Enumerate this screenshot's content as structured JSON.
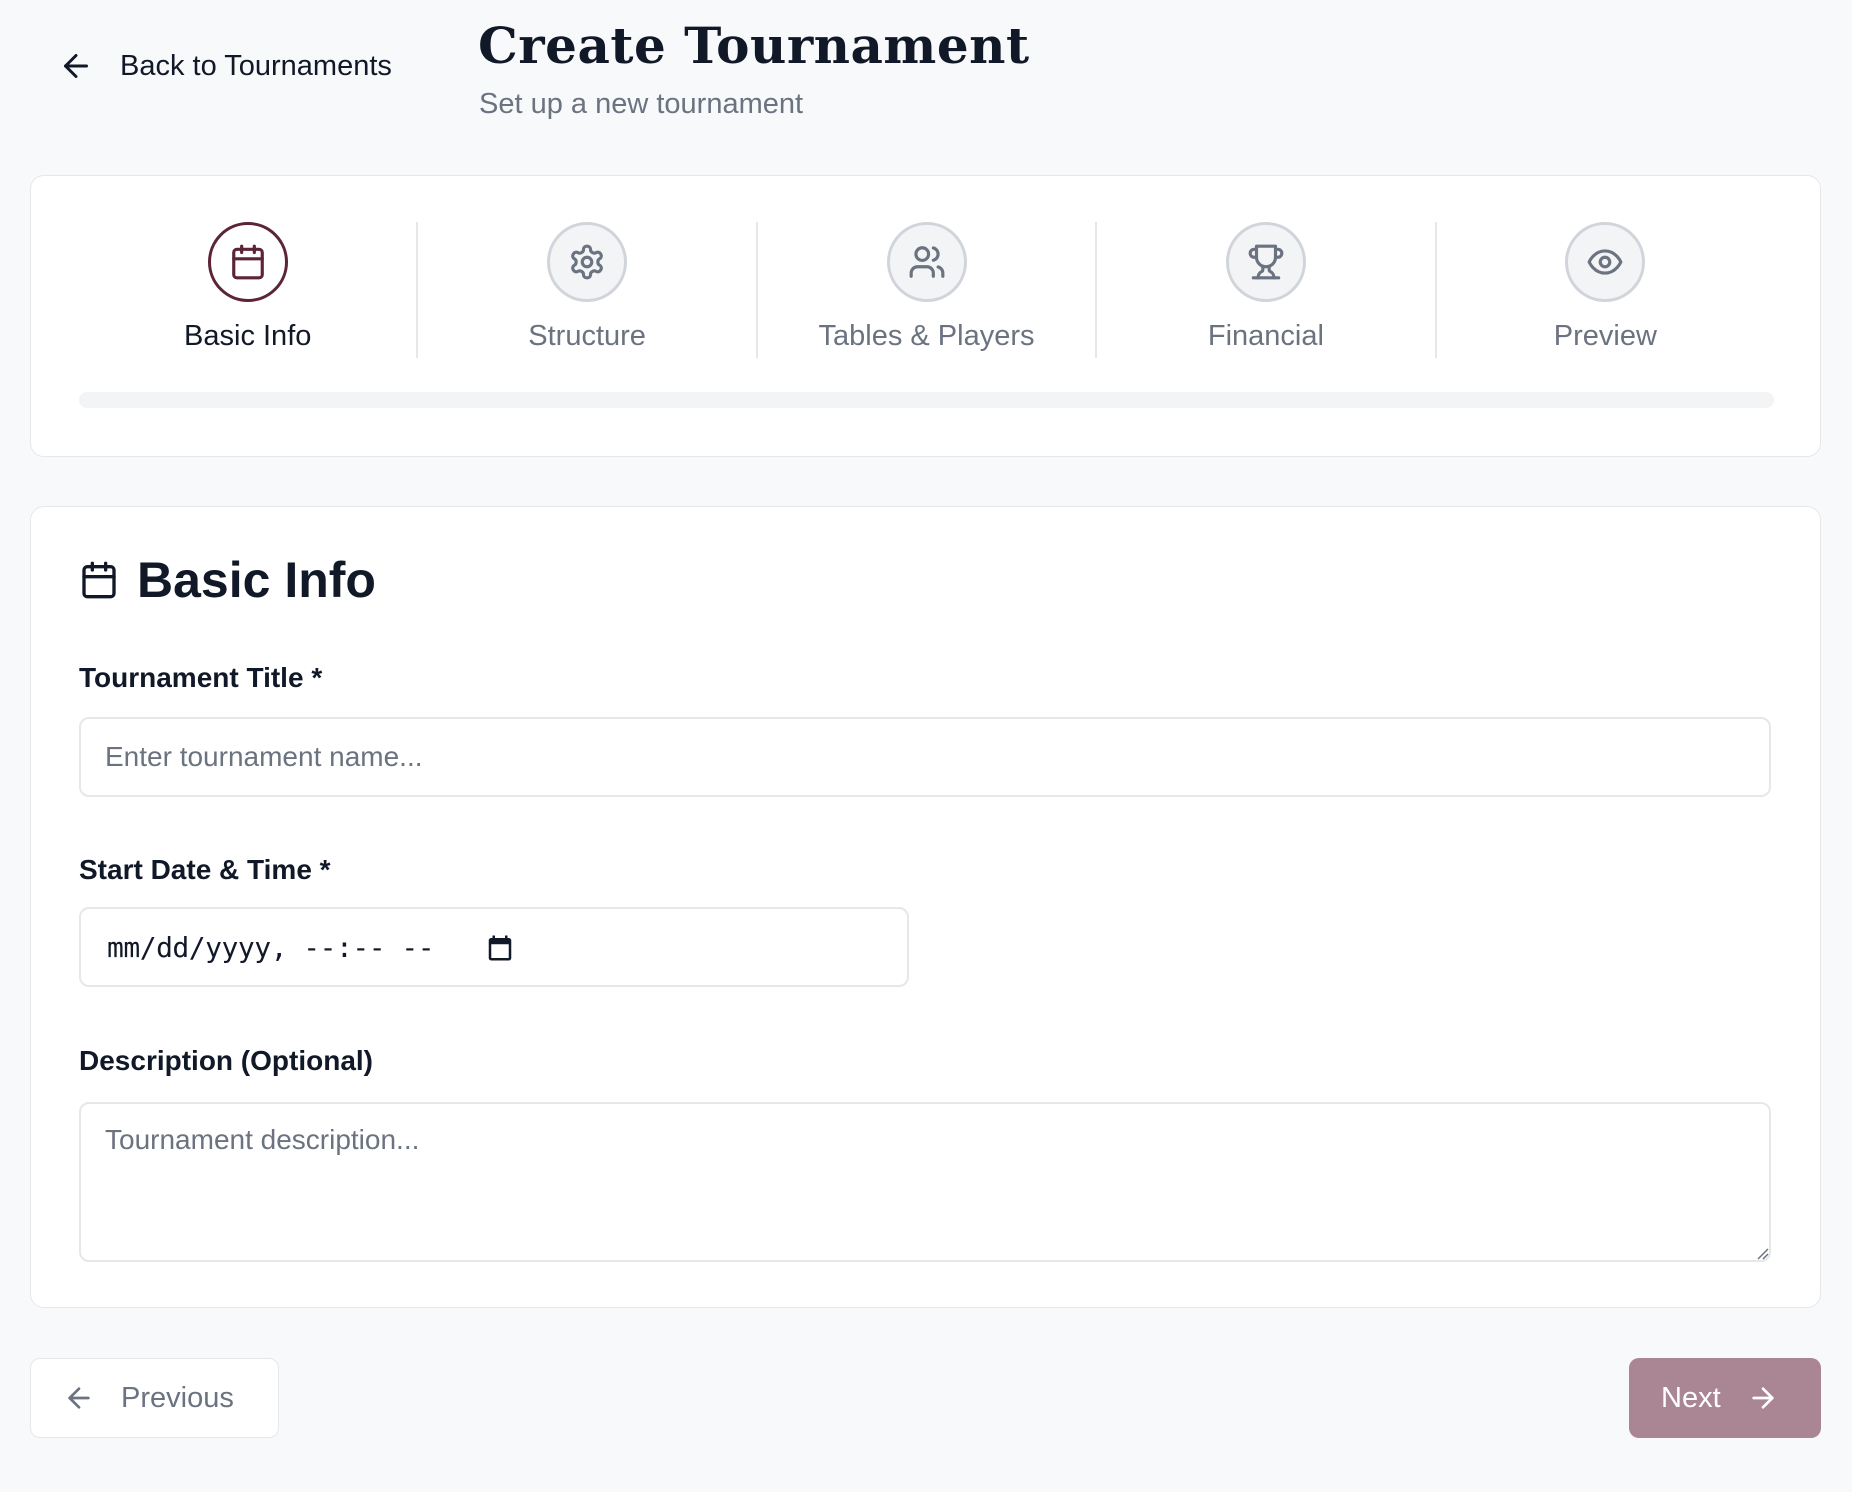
{
  "header": {
    "back_label": "Back to Tournaments",
    "title": "Create Tournament",
    "subtitle": "Set up a new tournament"
  },
  "stepper": {
    "steps": [
      {
        "label": "Basic Info",
        "icon": "calendar-icon",
        "active": true
      },
      {
        "label": "Structure",
        "icon": "gear-icon",
        "active": false
      },
      {
        "label": "Tables & Players",
        "icon": "users-icon",
        "active": false
      },
      {
        "label": "Financial",
        "icon": "trophy-icon",
        "active": false
      },
      {
        "label": "Preview",
        "icon": "eye-icon",
        "active": false
      }
    ],
    "progress_fraction": 0.0
  },
  "form": {
    "section_title": "Basic Info",
    "title_label": "Tournament Title *",
    "title_placeholder": "Enter tournament name...",
    "title_value": "",
    "date_label": "Start Date & Time *",
    "date_value_display": "mm/dd/yyyy, --:-- --",
    "description_label": "Description (Optional)",
    "description_placeholder": "Tournament description...",
    "description_value": ""
  },
  "footer": {
    "previous_label": "Previous",
    "next_label": "Next"
  },
  "colors": {
    "accent": "#5b2437",
    "next_button_disabled": "#aa8594",
    "background": "#f8f9fb",
    "border": "#e5e7eb",
    "muted_text": "#6b7280"
  }
}
